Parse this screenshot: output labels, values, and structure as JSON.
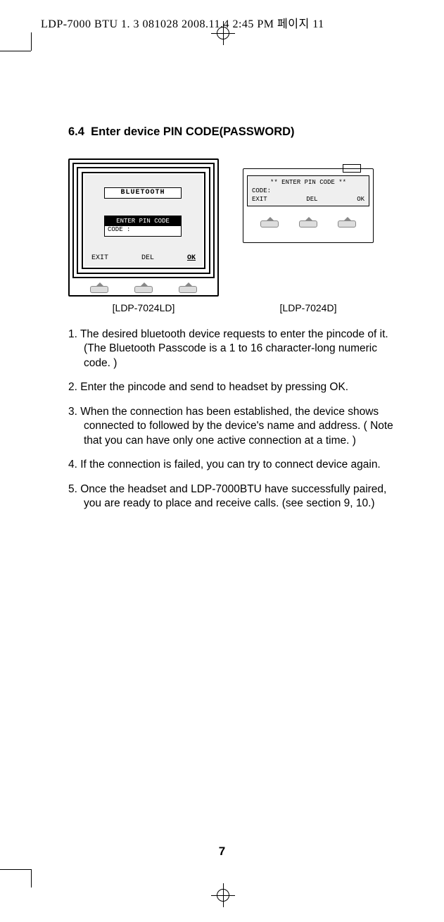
{
  "header": {
    "printer_mark": "LDP-7000 BTU 1. 3 081028  2008.11.4  2:45 PM  페이지 11"
  },
  "section": {
    "number": "6.4",
    "title": "Enter device PIN CODE(PASSWORD)"
  },
  "device1": {
    "caption": "[LDP-7024LD]",
    "screen_title": "BLUETOOTH",
    "enter_line": "ENTER PIN CODE",
    "code_line": "CODE :",
    "soft_exit": "EXIT",
    "soft_del": "DEL",
    "soft_ok": "OK"
  },
  "device2": {
    "caption": "[LDP-7024D]",
    "row1": "**  ENTER PIN CODE  **",
    "row2": "CODE:",
    "soft_exit": "EXIT",
    "soft_del": "DEL",
    "soft_ok": "OK"
  },
  "steps": {
    "s1": "1. The desired bluetooth device requests to enter the pincode of it. (The Bluetooth Passcode is a 1 to 16 character-long numeric code. )",
    "s2": "2. Enter the pincode and send to headset by pressing OK.",
    "s3": "3. When the connection has been established, the device shows connected to followed by the device's name and address. ( Note that you can have only one active connection at a time. )",
    "s4": "4. If the connection is failed, you can try to connect device again.",
    "s5": "5. Once the headset and LDP-7000BTU have successfully paired, you are ready to place and receive calls. (see section 9, 10.)"
  },
  "page_number": "7"
}
